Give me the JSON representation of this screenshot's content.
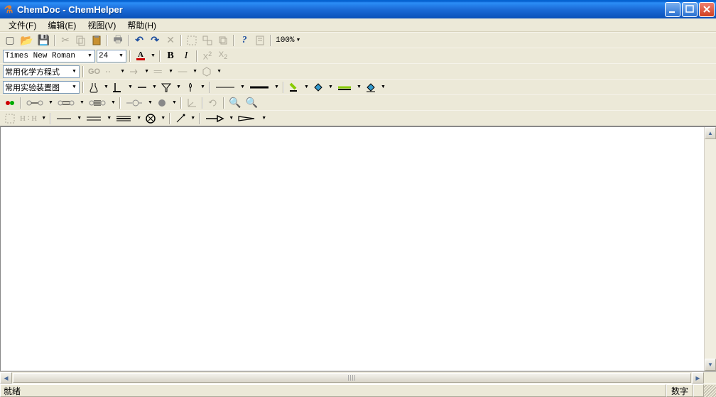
{
  "window": {
    "title": "ChemDoc - ChemHelper"
  },
  "menu": {
    "file": "文件(F)",
    "edit": "编辑(E)",
    "view": "视图(V)",
    "help": "帮助(H)"
  },
  "toolbar1": {
    "zoom": "100%"
  },
  "toolbar2": {
    "font": "Times New Roman",
    "fontsize": "24",
    "bold": "B",
    "italic": "I",
    "fontcolor_underline": "A"
  },
  "toolbar3": {
    "presets_label": "常用化学方程式",
    "go_label": "GO"
  },
  "toolbar4": {
    "apparatus_label": "常用实验装置图"
  },
  "toolbar6": {
    "hh_label": "H ∶ H"
  },
  "status": {
    "ready": "就绪",
    "num": "数字"
  }
}
